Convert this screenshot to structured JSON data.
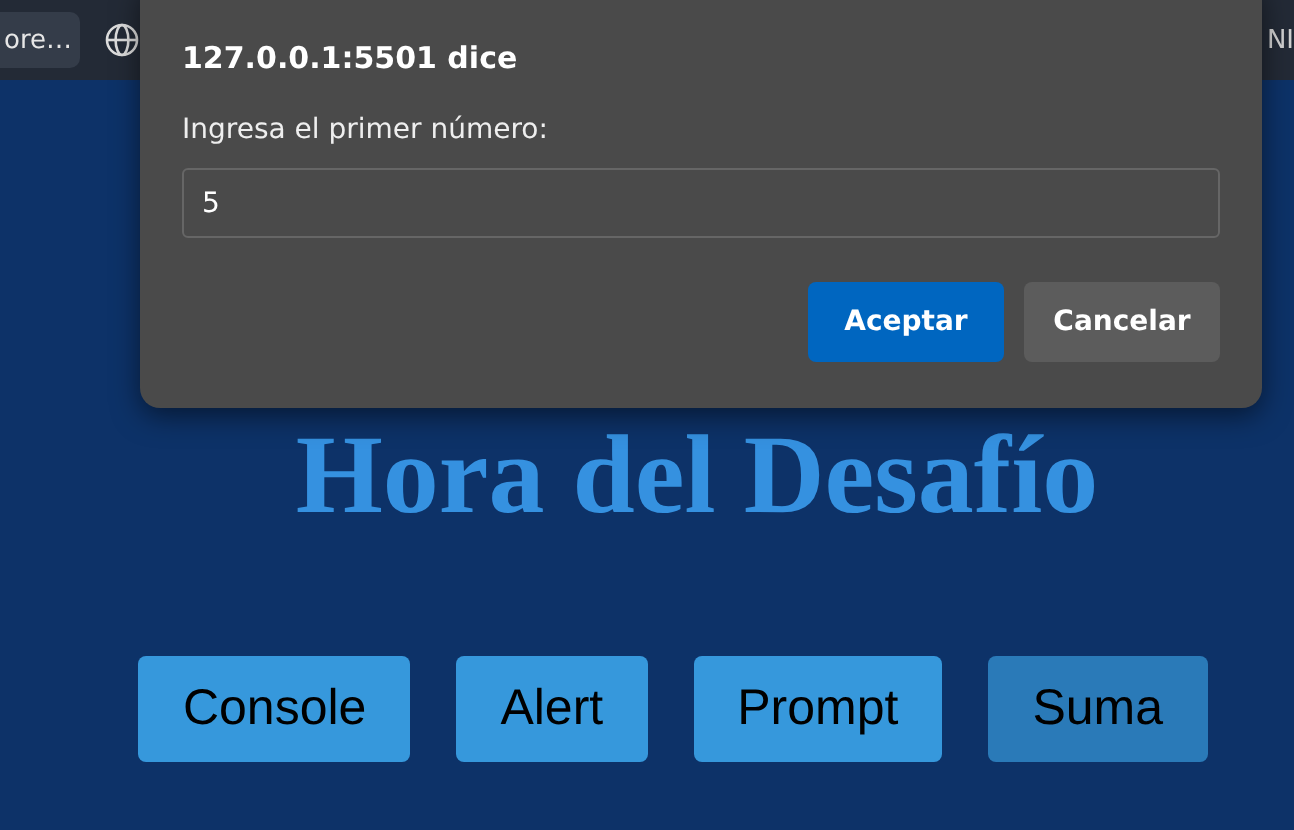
{
  "browser_bar": {
    "tab_label": "ore…",
    "right_label": "NI"
  },
  "heading": "Hora del Desafío",
  "buttons": [
    {
      "label": "Console",
      "hovered": false
    },
    {
      "label": "Alert",
      "hovered": false
    },
    {
      "label": "Prompt",
      "hovered": false
    },
    {
      "label": "Suma",
      "hovered": true
    }
  ],
  "dialog": {
    "title": "127.0.0.1:5501 dice",
    "message": "Ingresa el primer número:",
    "value": "5",
    "ok": "Aceptar",
    "cancel": "Cancelar"
  }
}
